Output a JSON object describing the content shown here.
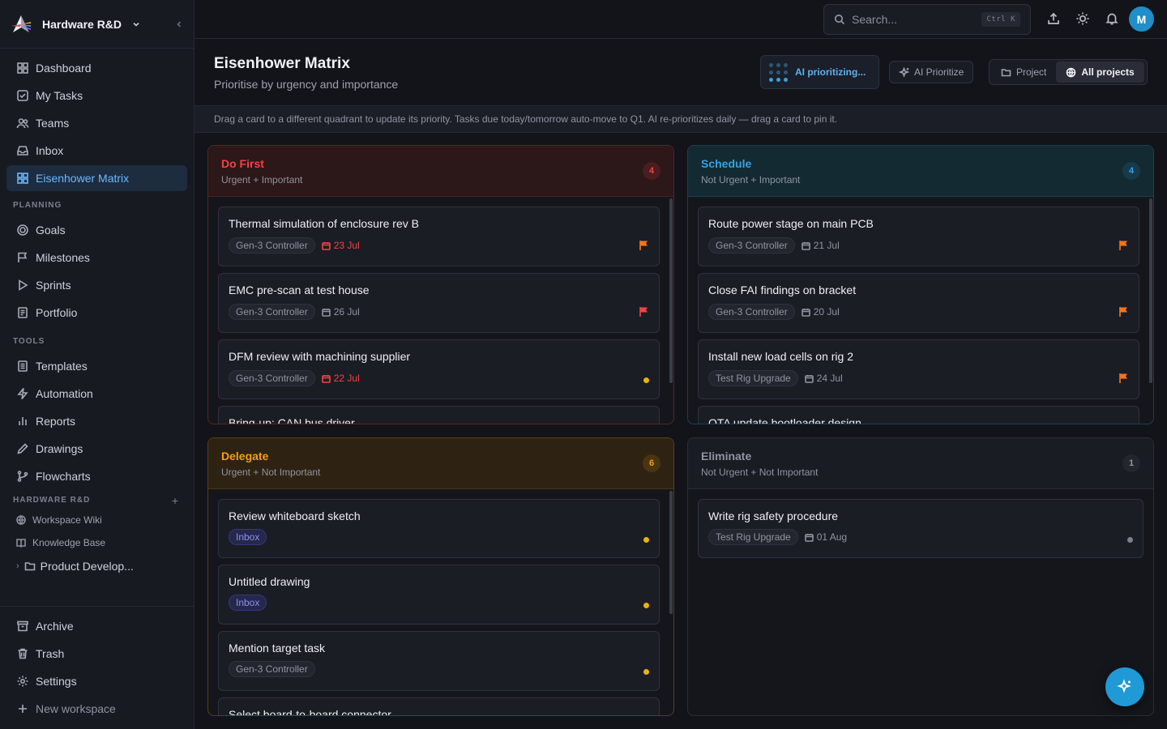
{
  "workspace": {
    "name": "Hardware R&D"
  },
  "nav": {
    "main": [
      {
        "label": "Dashboard",
        "icon": "grid-icon"
      },
      {
        "label": "My Tasks",
        "icon": "checkbox-icon"
      },
      {
        "label": "Teams",
        "icon": "users-icon"
      },
      {
        "label": "Inbox",
        "icon": "inbox-icon"
      },
      {
        "label": "Eisenhower Matrix",
        "icon": "matrix-icon",
        "active": true
      }
    ],
    "planning_label": "PLANNING",
    "planning": [
      {
        "label": "Goals",
        "icon": "target-icon"
      },
      {
        "label": "Milestones",
        "icon": "flag-icon"
      },
      {
        "label": "Sprints",
        "icon": "play-icon"
      },
      {
        "label": "Portfolio",
        "icon": "document-icon"
      }
    ],
    "tools_label": "TOOLS",
    "tools": [
      {
        "label": "Templates",
        "icon": "template-icon"
      },
      {
        "label": "Automation",
        "icon": "bolt-icon"
      },
      {
        "label": "Reports",
        "icon": "bar-chart-icon"
      },
      {
        "label": "Drawings",
        "icon": "pen-icon"
      },
      {
        "label": "Flowcharts",
        "icon": "flowchart-icon"
      }
    ],
    "workspace_label": "HARDWARE R&D",
    "workspace_items": [
      {
        "label": "Workspace Wiki",
        "icon": "globe-icon"
      },
      {
        "label": "Knowledge Base",
        "icon": "book-icon"
      }
    ],
    "folder": {
      "label": "Product Develop..."
    },
    "bottom": [
      {
        "label": "Archive",
        "icon": "archive-icon"
      },
      {
        "label": "Trash",
        "icon": "trash-icon"
      },
      {
        "label": "Settings",
        "icon": "gear-icon"
      },
      {
        "label": "New workspace",
        "icon": "plus-icon"
      }
    ]
  },
  "topbar": {
    "search_placeholder": "Search...",
    "shortcut": "Ctrl K",
    "avatar_initial": "M"
  },
  "header": {
    "title": "Eisenhower Matrix",
    "subtitle": "Prioritise by urgency and importance",
    "ai_status": "AI prioritizing...",
    "ai_button": "AI Prioritize",
    "scope_project": "Project",
    "scope_all": "All projects"
  },
  "hint": "Drag a card to a different quadrant to update its priority. Tasks due today/tomorrow auto-move to Q1. AI re-prioritizes daily — drag a card to pin it.",
  "quadrants": {
    "do_first": {
      "title": "Do First",
      "subtitle": "Urgent + Important",
      "count": "4",
      "color": "#ef4444",
      "cards": [
        {
          "title": "Thermal simulation of enclosure rev B",
          "tag": "Gen-3 Controller",
          "due": "23 Jul",
          "overdue": true,
          "priority": "flag-orange"
        },
        {
          "title": "EMC pre-scan at test house",
          "tag": "Gen-3 Controller",
          "due": "26 Jul",
          "overdue": false,
          "priority": "flag-red"
        },
        {
          "title": "DFM review with machining supplier",
          "tag": "Gen-3 Controller",
          "due": "22 Jul",
          "overdue": true,
          "priority": "dot-yellow"
        },
        {
          "title": "Bring-up: CAN bus driver"
        }
      ]
    },
    "schedule": {
      "title": "Schedule",
      "subtitle": "Not Urgent + Important",
      "count": "4",
      "color": "#3aa0e0",
      "cards": [
        {
          "title": "Route power stage on main PCB",
          "tag": "Gen-3 Controller",
          "due": "21 Jul",
          "priority": "flag-orange"
        },
        {
          "title": "Close FAI findings on bracket",
          "tag": "Gen-3 Controller",
          "due": "20 Jul",
          "priority": "flag-orange"
        },
        {
          "title": "Install new load cells on rig 2",
          "tag": "Test Rig Upgrade",
          "due": "24 Jul",
          "priority": "flag-orange"
        },
        {
          "title": "OTA update bootloader design"
        }
      ]
    },
    "delegate": {
      "title": "Delegate",
      "subtitle": "Urgent + Not Important",
      "count": "6",
      "color": "#f59e0b",
      "cards": [
        {
          "title": "Review whiteboard sketch",
          "tag": "Inbox",
          "priority": "dot-yellow"
        },
        {
          "title": "Untitled drawing",
          "tag": "Inbox",
          "priority": "dot-yellow"
        },
        {
          "title": "Mention target task",
          "tag": "Gen-3 Controller",
          "priority": "dot-yellow"
        },
        {
          "title": "Select board-to-board connector"
        }
      ]
    },
    "eliminate": {
      "title": "Eliminate",
      "subtitle": "Not Urgent + Not Important",
      "count": "1",
      "color": "#8f94a1",
      "cards": [
        {
          "title": "Write rig safety procedure",
          "tag": "Test Rig Upgrade",
          "due": "01 Aug",
          "priority": "dot-gray"
        }
      ]
    }
  }
}
